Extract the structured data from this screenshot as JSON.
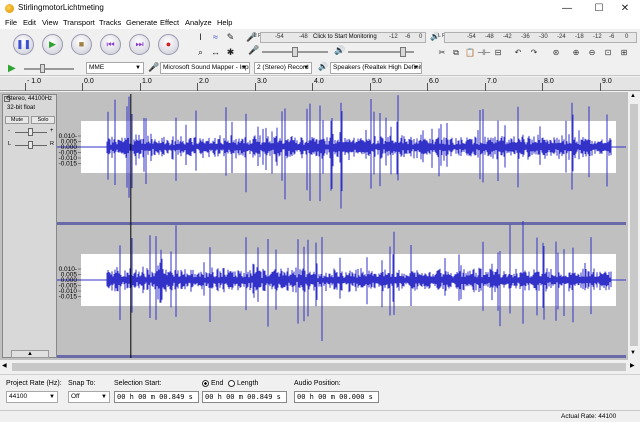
{
  "window": {
    "title": "StirlingmotorLichtmeting",
    "minimize_glyph": "—",
    "maximize_glyph": "☐",
    "close_glyph": "✕"
  },
  "menu": [
    "File",
    "Edit",
    "View",
    "Transport",
    "Tracks",
    "Generate",
    "Effect",
    "Analyze",
    "Help"
  ],
  "transport": [
    {
      "name": "pause-button",
      "glyph": "❚❚",
      "color": "#3b4fd0"
    },
    {
      "name": "play-button",
      "glyph": "▶",
      "color": "#2fa32f"
    },
    {
      "name": "stop-button",
      "glyph": "■",
      "color": "#a08040"
    },
    {
      "name": "skip-start-button",
      "glyph": "⏮",
      "color": "#8a3ad0"
    },
    {
      "name": "skip-end-button",
      "glyph": "⏭",
      "color": "#8a3ad0"
    },
    {
      "name": "record-button",
      "glyph": "●",
      "color": "#d02020"
    }
  ],
  "meters": {
    "record_scale": [
      "-54",
      "-48",
      "Click to Start Monitoring",
      "-12",
      "-6",
      "0"
    ],
    "playback_scale": [
      "-54",
      "-48",
      "-42",
      "-36",
      "-30",
      "-24",
      "-18",
      "-12",
      "-6",
      "0"
    ],
    "record_channels": "L R",
    "playback_channels": "L R"
  },
  "devices": {
    "host": "MME",
    "recording_device": "Microsoft Sound Mapper - Inp",
    "channels": "2 (Stereo) Record",
    "playback_device": "Speakers (Realtek High Definit"
  },
  "ruler_ticks": [
    {
      "label": "- 1.0",
      "value": -1.0
    },
    {
      "label": "0.0",
      "value": 0.0
    },
    {
      "label": "1.0",
      "value": 1.0
    },
    {
      "label": "2.0",
      "value": 2.0
    },
    {
      "label": "3.0",
      "value": 3.0
    },
    {
      "label": "4.0",
      "value": 4.0
    },
    {
      "label": "5.0",
      "value": 5.0
    },
    {
      "label": "6.0",
      "value": 6.0
    },
    {
      "label": "7.0",
      "value": 7.0
    },
    {
      "label": "8.0",
      "value": 8.0
    },
    {
      "label": "9.0",
      "value": 9.0
    }
  ],
  "track": {
    "info_line1": "Stereo, 44100Hz",
    "info_line2": "32-bit float",
    "mute": "Mute",
    "solo": "Solo",
    "gain_minus": "-",
    "gain_plus": "+",
    "pan_left": "L",
    "pan_right": "R",
    "collapse_glyph": "▲",
    "y_labels": [
      "0.010-",
      "0.005",
      "0.000",
      "-0.005",
      "-0.010",
      "-0.015"
    ],
    "y_values": [
      0.01,
      0.005,
      0.0,
      -0.005,
      -0.01,
      -0.015
    ],
    "cursor_seconds": 0.849
  },
  "colors": {
    "waveform": "#3232c8",
    "track_bg": "#c0c0c0",
    "selection_bg": "#ffffff"
  },
  "selection_toolbar": {
    "project_rate_label": "Project Rate (Hz):",
    "project_rate": "44100",
    "snap_label": "Snap To:",
    "snap_value": "Off",
    "selection_start_label": "Selection Start:",
    "end_label": "End",
    "length_label": "Length",
    "selection_start": "00 h 00 m 00.849 s",
    "selection_end": "00 h 00 m 00.849 s",
    "audio_position_label": "Audio Position:",
    "audio_position": "00 h 00 m 00.000 s"
  },
  "status": {
    "actual_rate": "Actual Rate: 44100"
  }
}
